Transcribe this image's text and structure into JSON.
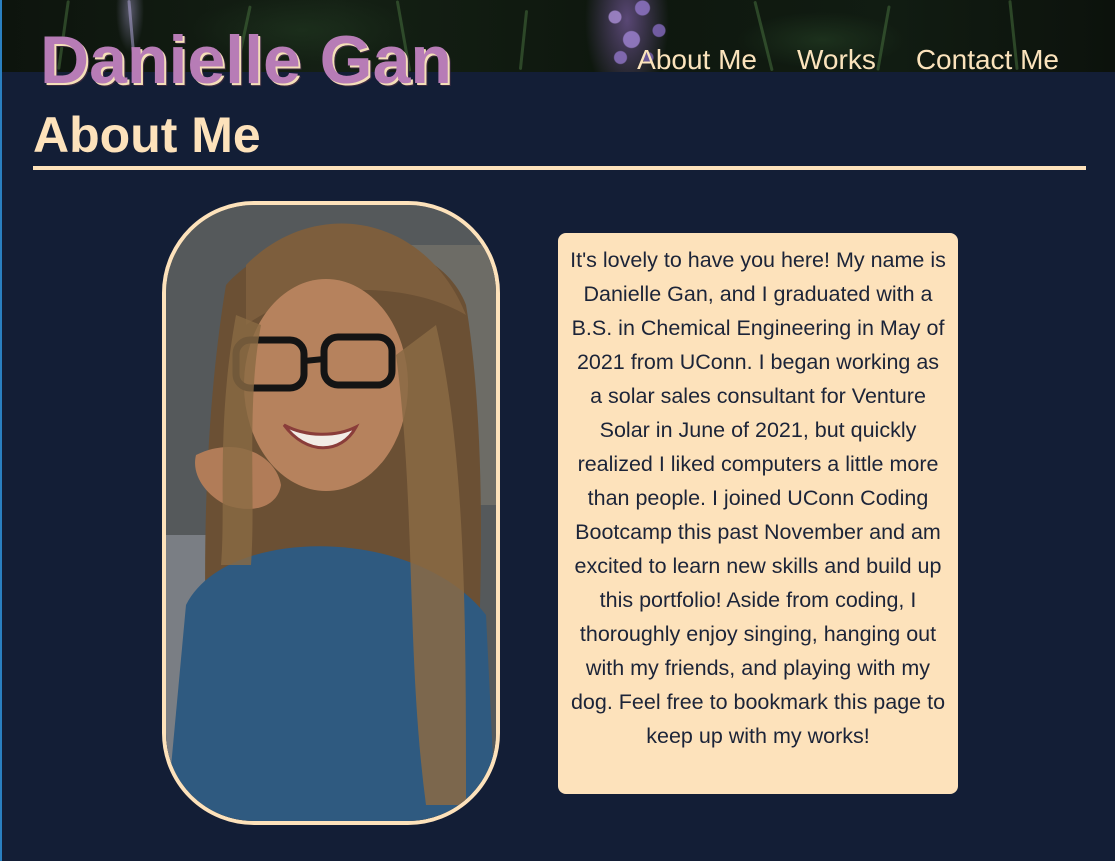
{
  "header": {
    "site_title": "Danielle Gan",
    "nav": [
      {
        "label": "About Me"
      },
      {
        "label": "Works"
      },
      {
        "label": "Contact Me"
      }
    ]
  },
  "about": {
    "heading": "About Me",
    "bio": "It's lovely to have you here! My name is Danielle Gan, and I graduated with a B.S. in Chemical Engineering in May of 2021 from UConn. I began working as a solar sales consultant for Venture Solar in June of 2021, but quickly realized I liked computers a little more than people. I joined UConn Coding Bootcamp this past November and am excited to learn new skills and build up this portfolio! Aside from coding, I thoroughly enjoy singing, hanging out with my friends, and playing with my dog. Feel free to bookmark this page to keep up with my works!"
  },
  "colors": {
    "background": "#131e36",
    "accent_cream": "#fde2bb",
    "title_purple": "#b77cb6",
    "card_text": "#1c2438"
  }
}
